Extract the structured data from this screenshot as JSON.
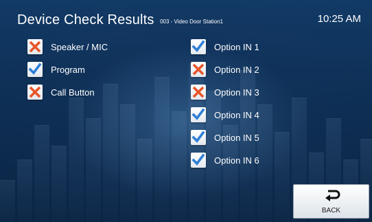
{
  "header": {
    "title": "Device Check Results",
    "subtitle": "003 - Video Door Station1",
    "time": "10:25 AM"
  },
  "results_left": [
    {
      "label": "Speaker / MIC",
      "status": "fail"
    },
    {
      "label": "Program",
      "status": "pass"
    },
    {
      "label": "Call Button",
      "status": "fail"
    }
  ],
  "results_right": [
    {
      "label": "Option IN 1",
      "status": "pass"
    },
    {
      "label": "Option IN 2",
      "status": "fail"
    },
    {
      "label": "Option IN 3",
      "status": "fail"
    },
    {
      "label": "Option IN 4",
      "status": "pass"
    },
    {
      "label": "Option IN 5",
      "status": "pass"
    },
    {
      "label": "Option IN 6",
      "status": "pass"
    }
  ],
  "back_button": {
    "label": "BACK",
    "icon": "return-arrow-icon"
  },
  "colors": {
    "pass": "#2f7fd6",
    "fail": "#e8562a"
  }
}
